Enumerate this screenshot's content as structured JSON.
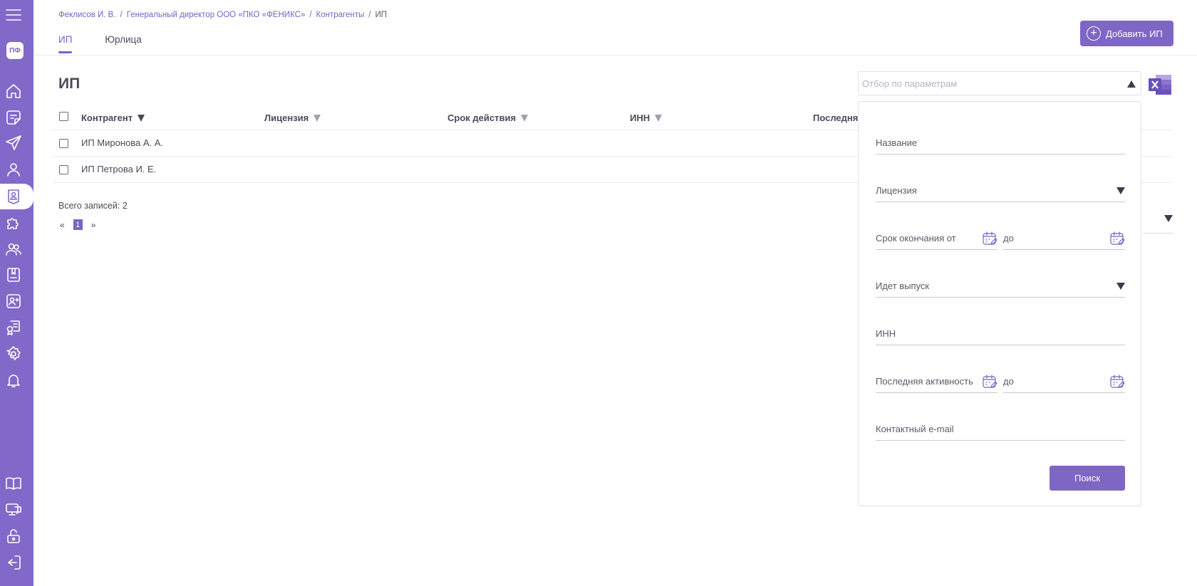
{
  "sidebar": {
    "logo_text": "ПФ",
    "items": [
      {
        "name": "menu-icon"
      },
      {
        "name": "home-icon"
      },
      {
        "name": "document-icon"
      },
      {
        "name": "send-icon"
      },
      {
        "name": "user-icon"
      },
      {
        "name": "contractor-badge-icon"
      },
      {
        "name": "puzzle-icon"
      },
      {
        "name": "users-group-icon"
      },
      {
        "name": "book-bookmark-icon"
      },
      {
        "name": "user-add-icon"
      },
      {
        "name": "certificate-icon"
      },
      {
        "name": "settings-icon"
      },
      {
        "name": "bell-icon"
      },
      {
        "name": "manual-book-icon"
      },
      {
        "name": "monitor-chat-icon"
      },
      {
        "name": "unlock-icon"
      },
      {
        "name": "logout-icon"
      }
    ]
  },
  "breadcrumb": {
    "items": [
      "Феклисов И. В.",
      "Генеральный директор ООО «ПКО «ФЕНИКС»",
      "Контрагенты"
    ],
    "current": "ИП",
    "separator": "/"
  },
  "tabs": [
    {
      "label": "ИП",
      "active": true
    },
    {
      "label": "Юрлица",
      "active": false
    }
  ],
  "toolbar": {
    "add_label": "Добавить ИП",
    "filter_placeholder": "Отбор по параметрам"
  },
  "page_title": "ИП",
  "table": {
    "columns": [
      "Контрагент",
      "Лицензия",
      "Срок действия",
      "ИНН",
      "Последня"
    ],
    "rows": [
      {
        "name": "ИП Миронова А. А."
      },
      {
        "name": "ИП Петрова И. Е."
      }
    ],
    "total_label": "Всего записей: 2",
    "pager": {
      "prev": "«",
      "page": "1",
      "next": "»"
    }
  },
  "filter_panel": {
    "name_label": "Название",
    "license_label": "Лицензия",
    "expiry_from_label": "Срок окончания от",
    "expiry_to_label": "до",
    "release_label": "Идет выпуск",
    "inn_label": "ИНН",
    "activity_from_label": "Последняя активность",
    "activity_to_label": "до",
    "email_label": "Контактный e-mail",
    "search_label": "Поиск"
  },
  "colors": {
    "accent": "#7b62c6",
    "sidebar": "#8268c9",
    "text": "#4a4a5a"
  }
}
